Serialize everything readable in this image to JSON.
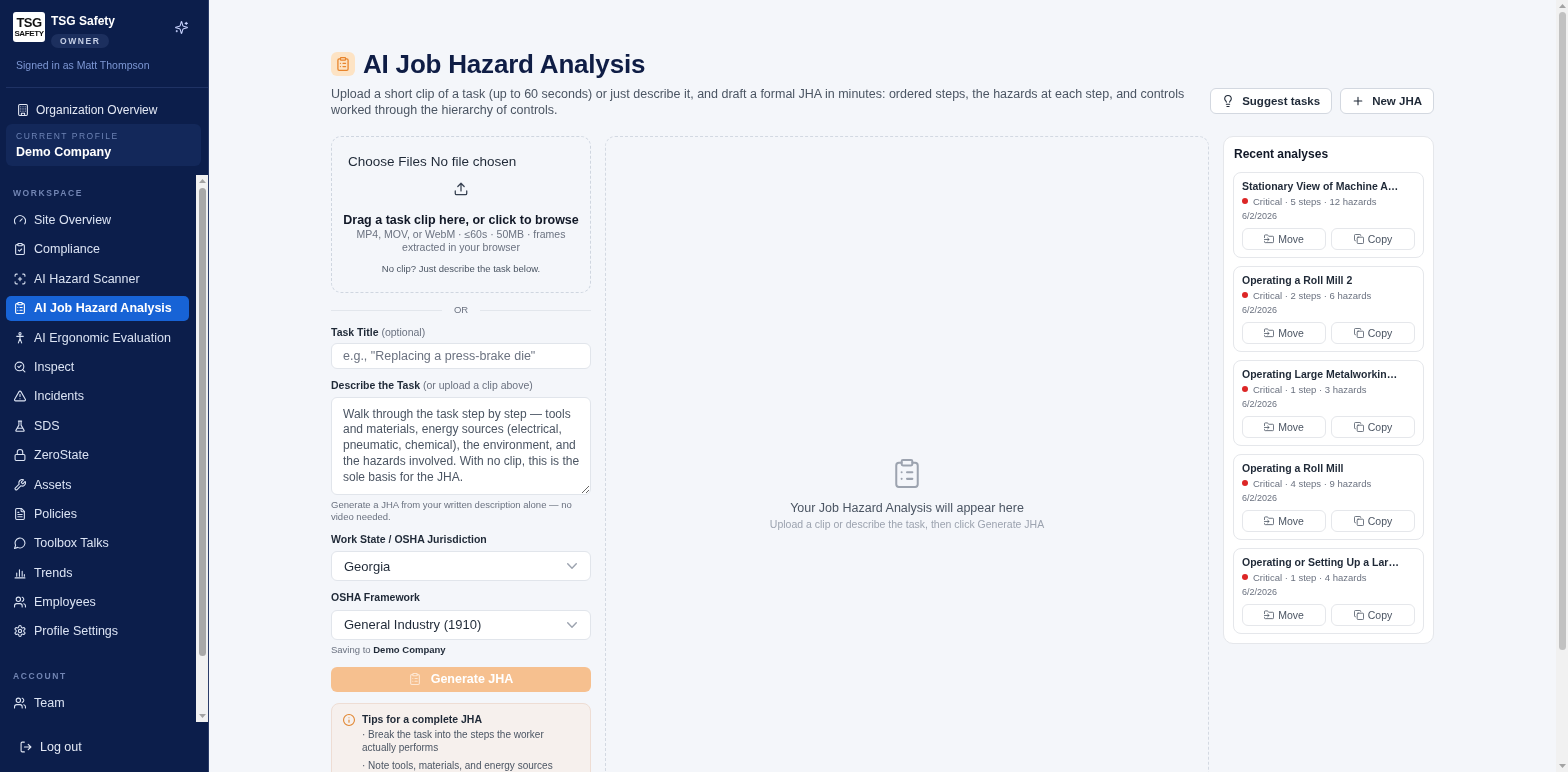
{
  "sidebar": {
    "brand": {
      "logo_text": "TSG",
      "logo_subtext": "SAFETY",
      "name": "TSG Safety",
      "badge": "OWNER"
    },
    "signed_in": "Signed in as Matt Thompson",
    "org_link": "Organization Overview",
    "current_profile": {
      "label": "CURRENT PROFILE",
      "name": "Demo Company"
    },
    "sections": [
      {
        "heading": "WORKSPACE",
        "items": [
          {
            "label": "Site Overview",
            "selected": false
          },
          {
            "label": "Compliance",
            "selected": false
          },
          {
            "label": "AI Hazard Scanner",
            "selected": false
          },
          {
            "label": "AI Job Hazard Analysis",
            "selected": true
          },
          {
            "label": "AI Ergonomic Evaluation",
            "selected": false
          },
          {
            "label": "Inspect",
            "selected": false
          },
          {
            "label": "Incidents",
            "selected": false
          },
          {
            "label": "SDS",
            "selected": false
          },
          {
            "label": "ZeroState",
            "selected": false
          },
          {
            "label": "Assets",
            "selected": false
          },
          {
            "label": "Policies",
            "selected": false
          },
          {
            "label": "Toolbox Talks",
            "selected": false
          },
          {
            "label": "Trends",
            "selected": false
          },
          {
            "label": "Employees",
            "selected": false
          },
          {
            "label": "Profile Settings",
            "selected": false
          }
        ]
      },
      {
        "heading": "ACCOUNT",
        "items": [
          {
            "label": "Team",
            "selected": false
          }
        ]
      }
    ],
    "logout": "Log out"
  },
  "header": {
    "title": "AI Job Hazard Analysis",
    "description": "Upload a short clip of a task (up to 60 seconds) or just describe it, and draft a formal JHA in minutes: ordered steps, the hazards at each step, and controls worked through the hierarchy of controls.",
    "buttons": [
      {
        "label": "Suggest tasks",
        "kind": "suggest"
      },
      {
        "label": "New JHA",
        "kind": "new"
      }
    ]
  },
  "upload": {
    "file_button": "Choose Files",
    "file_status": "No file chosen",
    "prompt": "Drag a task clip here, or click to browse",
    "formats": "MP4, MOV, or WebM · ≤60s · 50MB · frames extracted in your browser",
    "no_clip": "No clip? Just describe the task below."
  },
  "divider": "OR",
  "form": {
    "fields": [
      {
        "kind": "text",
        "label": "**Task Title** (optional)",
        "placeholder": "e.g., \"Replacing a press-brake die\""
      },
      {
        "kind": "textarea",
        "label": "**Describe the Task** (or upload a clip above)",
        "placeholder": "Walk through the task step by step — tools and materials, energy sources (electrical, pneumatic, chemical), the environment, and the hazards involved. With no clip, this is the sole basis for the JHA.",
        "hint": "Generate a JHA from your written description alone — no video needed."
      },
      {
        "kind": "select",
        "label": "Work State / OSHA Jurisdiction",
        "value": "Georgia"
      },
      {
        "kind": "select",
        "label": "OSHA Framework",
        "value": "General Industry (1910)"
      }
    ],
    "saving_to": "Saving to **Demo Company**",
    "generate": {
      "label": "Generate JHA",
      "disabled": true
    }
  },
  "tips": {
    "title": "Tips for a complete JHA",
    "items": [
      "· Break the task into the steps the worker actually performs",
      "· Note tools, materials, and energy sources"
    ]
  },
  "result": {
    "title": "Your Job Hazard Analysis will appear here",
    "subtitle": "Upload a clip or describe the task, then click Generate JHA"
  },
  "recent": {
    "title": "Recent analyses",
    "items": [
      {
        "title": "Stationary View of Machine A…",
        "color": "#dc2626",
        "meta": "Critical · 5 steps · 12 hazards",
        "date": "6/2/2026",
        "actions": [
          {
            "label": "Move",
            "kind": "move"
          },
          {
            "label": "Copy",
            "kind": "copy"
          }
        ]
      },
      {
        "title": "Operating a Roll Mill 2",
        "color": "#dc2626",
        "meta": "Critical · 2 steps · 6 hazards",
        "date": "6/2/2026",
        "actions": [
          {
            "label": "Move",
            "kind": "move"
          },
          {
            "label": "Copy",
            "kind": "copy"
          }
        ]
      },
      {
        "title": "Operating Large Metalworkin…",
        "color": "#dc2626",
        "meta": "Critical · 1 step · 3 hazards",
        "date": "6/2/2026",
        "actions": [
          {
            "label": "Move",
            "kind": "move"
          },
          {
            "label": "Copy",
            "kind": "copy"
          }
        ]
      },
      {
        "title": "Operating a Roll Mill",
        "color": "#dc2626",
        "meta": "Critical · 4 steps · 9 hazards",
        "date": "6/2/2026",
        "actions": [
          {
            "label": "Move",
            "kind": "move"
          },
          {
            "label": "Copy",
            "kind": "copy"
          }
        ]
      },
      {
        "title": "Operating or Setting Up a Lar…",
        "color": "#dc2626",
        "meta": "Critical · 1 step · 4 hazards",
        "date": "6/2/2026",
        "actions": [
          {
            "label": "Move",
            "kind": "move"
          },
          {
            "label": "Copy",
            "kind": "copy"
          }
        ]
      }
    ]
  }
}
